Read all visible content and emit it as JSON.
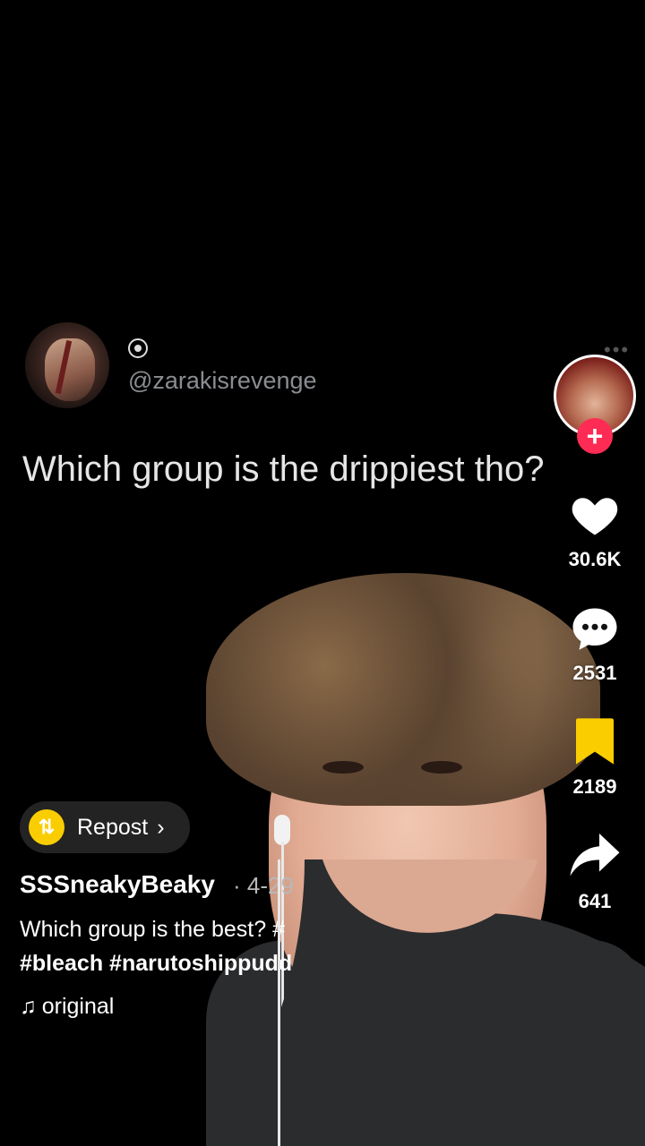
{
  "tweet": {
    "handle": "@zarakisrevenge",
    "text": "Which group is the drippiest tho?",
    "more_glyph": "•••"
  },
  "sidebar": {
    "follow_glyph": "+",
    "likes": "30.6K",
    "comments": "2531",
    "saves": "2189",
    "shares": "641"
  },
  "repost": {
    "label": "Repost",
    "chevron": "›",
    "icon": "repost-icon"
  },
  "post": {
    "username": "SSSneakyBeaky",
    "date": "· 4-29",
    "caption": "Which group is the best? #",
    "hashtags": "#bleach #narutoshippudde",
    "sound": "original"
  },
  "colors": {
    "follow": "#fe2c55",
    "save": "#facd00",
    "repost": "#facd00",
    "handle": "#8a8d91"
  }
}
